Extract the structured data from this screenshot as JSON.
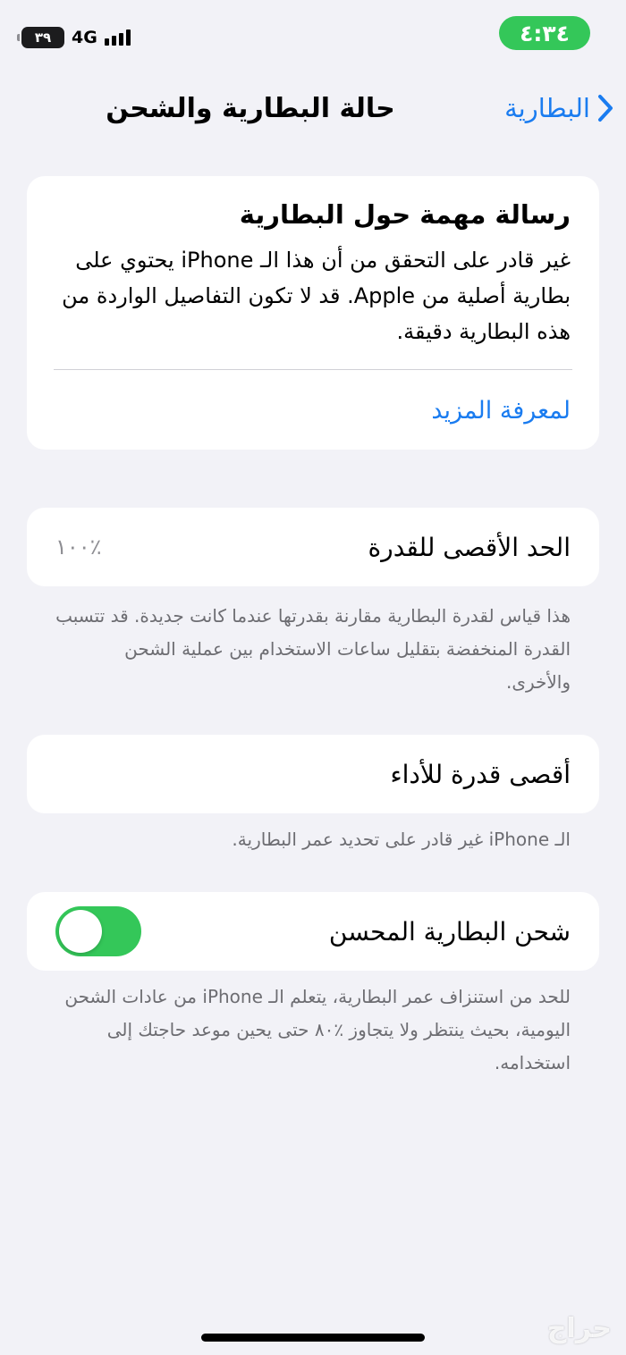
{
  "status_bar": {
    "time": "٤:٣٤",
    "battery_level": "٣٩",
    "network": "4G",
    "signal_bars": 4
  },
  "nav": {
    "back_label": "البطارية",
    "title": "حالة البطارية والشحن"
  },
  "important_message": {
    "title": "رسالة مهمة حول البطارية",
    "body": "غير قادر على التحقق من أن هذا الـ iPhone يحتوي على بطارية أصلية من Apple. قد لا تكون التفاصيل الواردة من هذه البطارية دقيقة.",
    "link": "لمعرفة المزيد"
  },
  "maximum_capacity": {
    "label": "الحد الأقصى للقدرة",
    "value": "٪١٠٠",
    "footnote": "هذا قياس لقدرة البطارية مقارنة بقدرتها عندما كانت جديدة. قد تتسبب القدرة المنخفضة بتقليل ساعات الاستخدام بين عملية الشحن والأخرى."
  },
  "peak_performance": {
    "label": "أقصى قدرة للأداء",
    "footnote": "الـ iPhone غير قادر على تحديد عمر البطارية."
  },
  "optimized_charging": {
    "label": "شحن البطارية المحسن",
    "enabled": true,
    "footnote": "للحد من استنزاف عمر البطارية، يتعلم الـ iPhone من عادات الشحن اليومية، بحيث ينتظر ولا يتجاوز ٪٨٠ حتى يحين موعد حاجتك إلى استخدامه."
  },
  "watermark": "حراج",
  "colors": {
    "accent": "#1a7cf0",
    "toggle_on": "#34c759",
    "background": "#f2f2f7",
    "footnote": "#6d6d72"
  }
}
